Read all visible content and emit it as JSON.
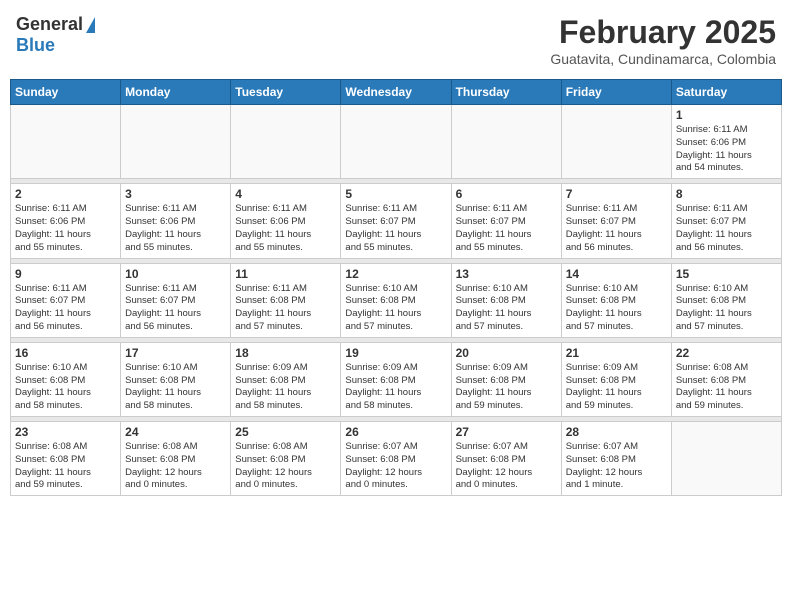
{
  "header": {
    "logo_general": "General",
    "logo_blue": "Blue",
    "month_year": "February 2025",
    "location": "Guatavita, Cundinamarca, Colombia"
  },
  "calendar": {
    "days_of_week": [
      "Sunday",
      "Monday",
      "Tuesday",
      "Wednesday",
      "Thursday",
      "Friday",
      "Saturday"
    ],
    "weeks": [
      {
        "days": [
          {
            "number": "",
            "info": ""
          },
          {
            "number": "",
            "info": ""
          },
          {
            "number": "",
            "info": ""
          },
          {
            "number": "",
            "info": ""
          },
          {
            "number": "",
            "info": ""
          },
          {
            "number": "",
            "info": ""
          },
          {
            "number": "1",
            "info": "Sunrise: 6:11 AM\nSunset: 6:06 PM\nDaylight: 11 hours\nand 54 minutes."
          }
        ]
      },
      {
        "days": [
          {
            "number": "2",
            "info": "Sunrise: 6:11 AM\nSunset: 6:06 PM\nDaylight: 11 hours\nand 55 minutes."
          },
          {
            "number": "3",
            "info": "Sunrise: 6:11 AM\nSunset: 6:06 PM\nDaylight: 11 hours\nand 55 minutes."
          },
          {
            "number": "4",
            "info": "Sunrise: 6:11 AM\nSunset: 6:06 PM\nDaylight: 11 hours\nand 55 minutes."
          },
          {
            "number": "5",
            "info": "Sunrise: 6:11 AM\nSunset: 6:07 PM\nDaylight: 11 hours\nand 55 minutes."
          },
          {
            "number": "6",
            "info": "Sunrise: 6:11 AM\nSunset: 6:07 PM\nDaylight: 11 hours\nand 55 minutes."
          },
          {
            "number": "7",
            "info": "Sunrise: 6:11 AM\nSunset: 6:07 PM\nDaylight: 11 hours\nand 56 minutes."
          },
          {
            "number": "8",
            "info": "Sunrise: 6:11 AM\nSunset: 6:07 PM\nDaylight: 11 hours\nand 56 minutes."
          }
        ]
      },
      {
        "days": [
          {
            "number": "9",
            "info": "Sunrise: 6:11 AM\nSunset: 6:07 PM\nDaylight: 11 hours\nand 56 minutes."
          },
          {
            "number": "10",
            "info": "Sunrise: 6:11 AM\nSunset: 6:07 PM\nDaylight: 11 hours\nand 56 minutes."
          },
          {
            "number": "11",
            "info": "Sunrise: 6:11 AM\nSunset: 6:08 PM\nDaylight: 11 hours\nand 57 minutes."
          },
          {
            "number": "12",
            "info": "Sunrise: 6:10 AM\nSunset: 6:08 PM\nDaylight: 11 hours\nand 57 minutes."
          },
          {
            "number": "13",
            "info": "Sunrise: 6:10 AM\nSunset: 6:08 PM\nDaylight: 11 hours\nand 57 minutes."
          },
          {
            "number": "14",
            "info": "Sunrise: 6:10 AM\nSunset: 6:08 PM\nDaylight: 11 hours\nand 57 minutes."
          },
          {
            "number": "15",
            "info": "Sunrise: 6:10 AM\nSunset: 6:08 PM\nDaylight: 11 hours\nand 57 minutes."
          }
        ]
      },
      {
        "days": [
          {
            "number": "16",
            "info": "Sunrise: 6:10 AM\nSunset: 6:08 PM\nDaylight: 11 hours\nand 58 minutes."
          },
          {
            "number": "17",
            "info": "Sunrise: 6:10 AM\nSunset: 6:08 PM\nDaylight: 11 hours\nand 58 minutes."
          },
          {
            "number": "18",
            "info": "Sunrise: 6:09 AM\nSunset: 6:08 PM\nDaylight: 11 hours\nand 58 minutes."
          },
          {
            "number": "19",
            "info": "Sunrise: 6:09 AM\nSunset: 6:08 PM\nDaylight: 11 hours\nand 58 minutes."
          },
          {
            "number": "20",
            "info": "Sunrise: 6:09 AM\nSunset: 6:08 PM\nDaylight: 11 hours\nand 59 minutes."
          },
          {
            "number": "21",
            "info": "Sunrise: 6:09 AM\nSunset: 6:08 PM\nDaylight: 11 hours\nand 59 minutes."
          },
          {
            "number": "22",
            "info": "Sunrise: 6:08 AM\nSunset: 6:08 PM\nDaylight: 11 hours\nand 59 minutes."
          }
        ]
      },
      {
        "days": [
          {
            "number": "23",
            "info": "Sunrise: 6:08 AM\nSunset: 6:08 PM\nDaylight: 11 hours\nand 59 minutes."
          },
          {
            "number": "24",
            "info": "Sunrise: 6:08 AM\nSunset: 6:08 PM\nDaylight: 12 hours\nand 0 minutes."
          },
          {
            "number": "25",
            "info": "Sunrise: 6:08 AM\nSunset: 6:08 PM\nDaylight: 12 hours\nand 0 minutes."
          },
          {
            "number": "26",
            "info": "Sunrise: 6:07 AM\nSunset: 6:08 PM\nDaylight: 12 hours\nand 0 minutes."
          },
          {
            "number": "27",
            "info": "Sunrise: 6:07 AM\nSunset: 6:08 PM\nDaylight: 12 hours\nand 0 minutes."
          },
          {
            "number": "28",
            "info": "Sunrise: 6:07 AM\nSunset: 6:08 PM\nDaylight: 12 hours\nand 1 minute."
          },
          {
            "number": "",
            "info": ""
          }
        ]
      }
    ]
  }
}
